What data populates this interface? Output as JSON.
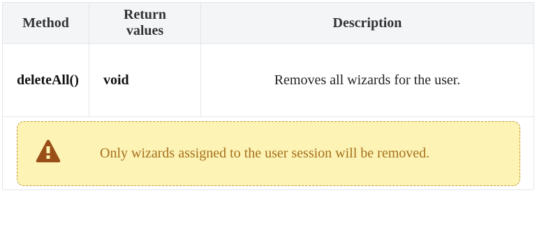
{
  "table": {
    "headers": [
      "Method",
      "Return values",
      "Description"
    ],
    "rows": [
      {
        "method": "deleteAll()",
        "return_value": "void",
        "description": "Removes all wizards for the user."
      }
    ],
    "note": {
      "icon": "warning-triangle-icon",
      "text": "Only wizards assigned to the user session will be removed.",
      "background_color": "#fcf3b5",
      "border_color": "#c29a3c",
      "text_color": "#a66f1a",
      "icon_color": "#994f17"
    }
  }
}
